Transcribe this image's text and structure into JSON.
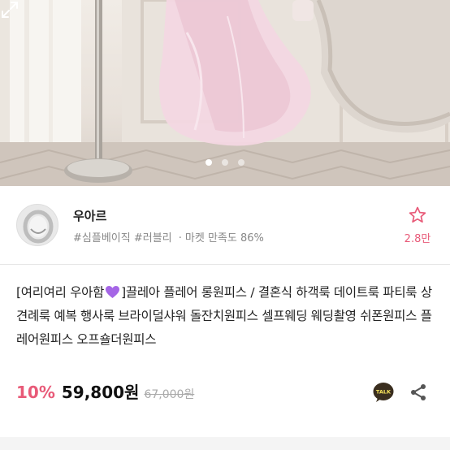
{
  "gallery": {
    "image_alt": "pink flare dress on mannequin",
    "slide_count": 3,
    "active_slide": 1,
    "expand_icon": "expand-icon"
  },
  "shop": {
    "name": "우아르",
    "tags": [
      "#심플베이직",
      "#러블리"
    ],
    "separator": "·",
    "satisfaction": "마켓 만족도 86%",
    "like_icon": "star-icon",
    "like_count": "2.8만"
  },
  "product": {
    "title_prefix": "[여리여리 우아함",
    "title_emoji": "purple-heart-icon",
    "title_main": "]끌레아 플레어 롱원피스 / 결혼식 하객룩 데이트룩 파티룩 상견례룩 예복 행사룩 브라이덜샤워 돌잔치원피스 셀프웨딩 웨딩촬영 쉬폰원피스 플레어원피스 오프숄더원피스",
    "discount": "10%",
    "price": "59,800원",
    "original_price": "67,000원",
    "talk_icon": "kakao-talk-icon",
    "talk_label": "TALK",
    "share_icon": "share-icon"
  },
  "colors": {
    "accent": "#e85a78",
    "talk_bg": "#3a2e1f",
    "talk_text": "#f6e25a"
  }
}
